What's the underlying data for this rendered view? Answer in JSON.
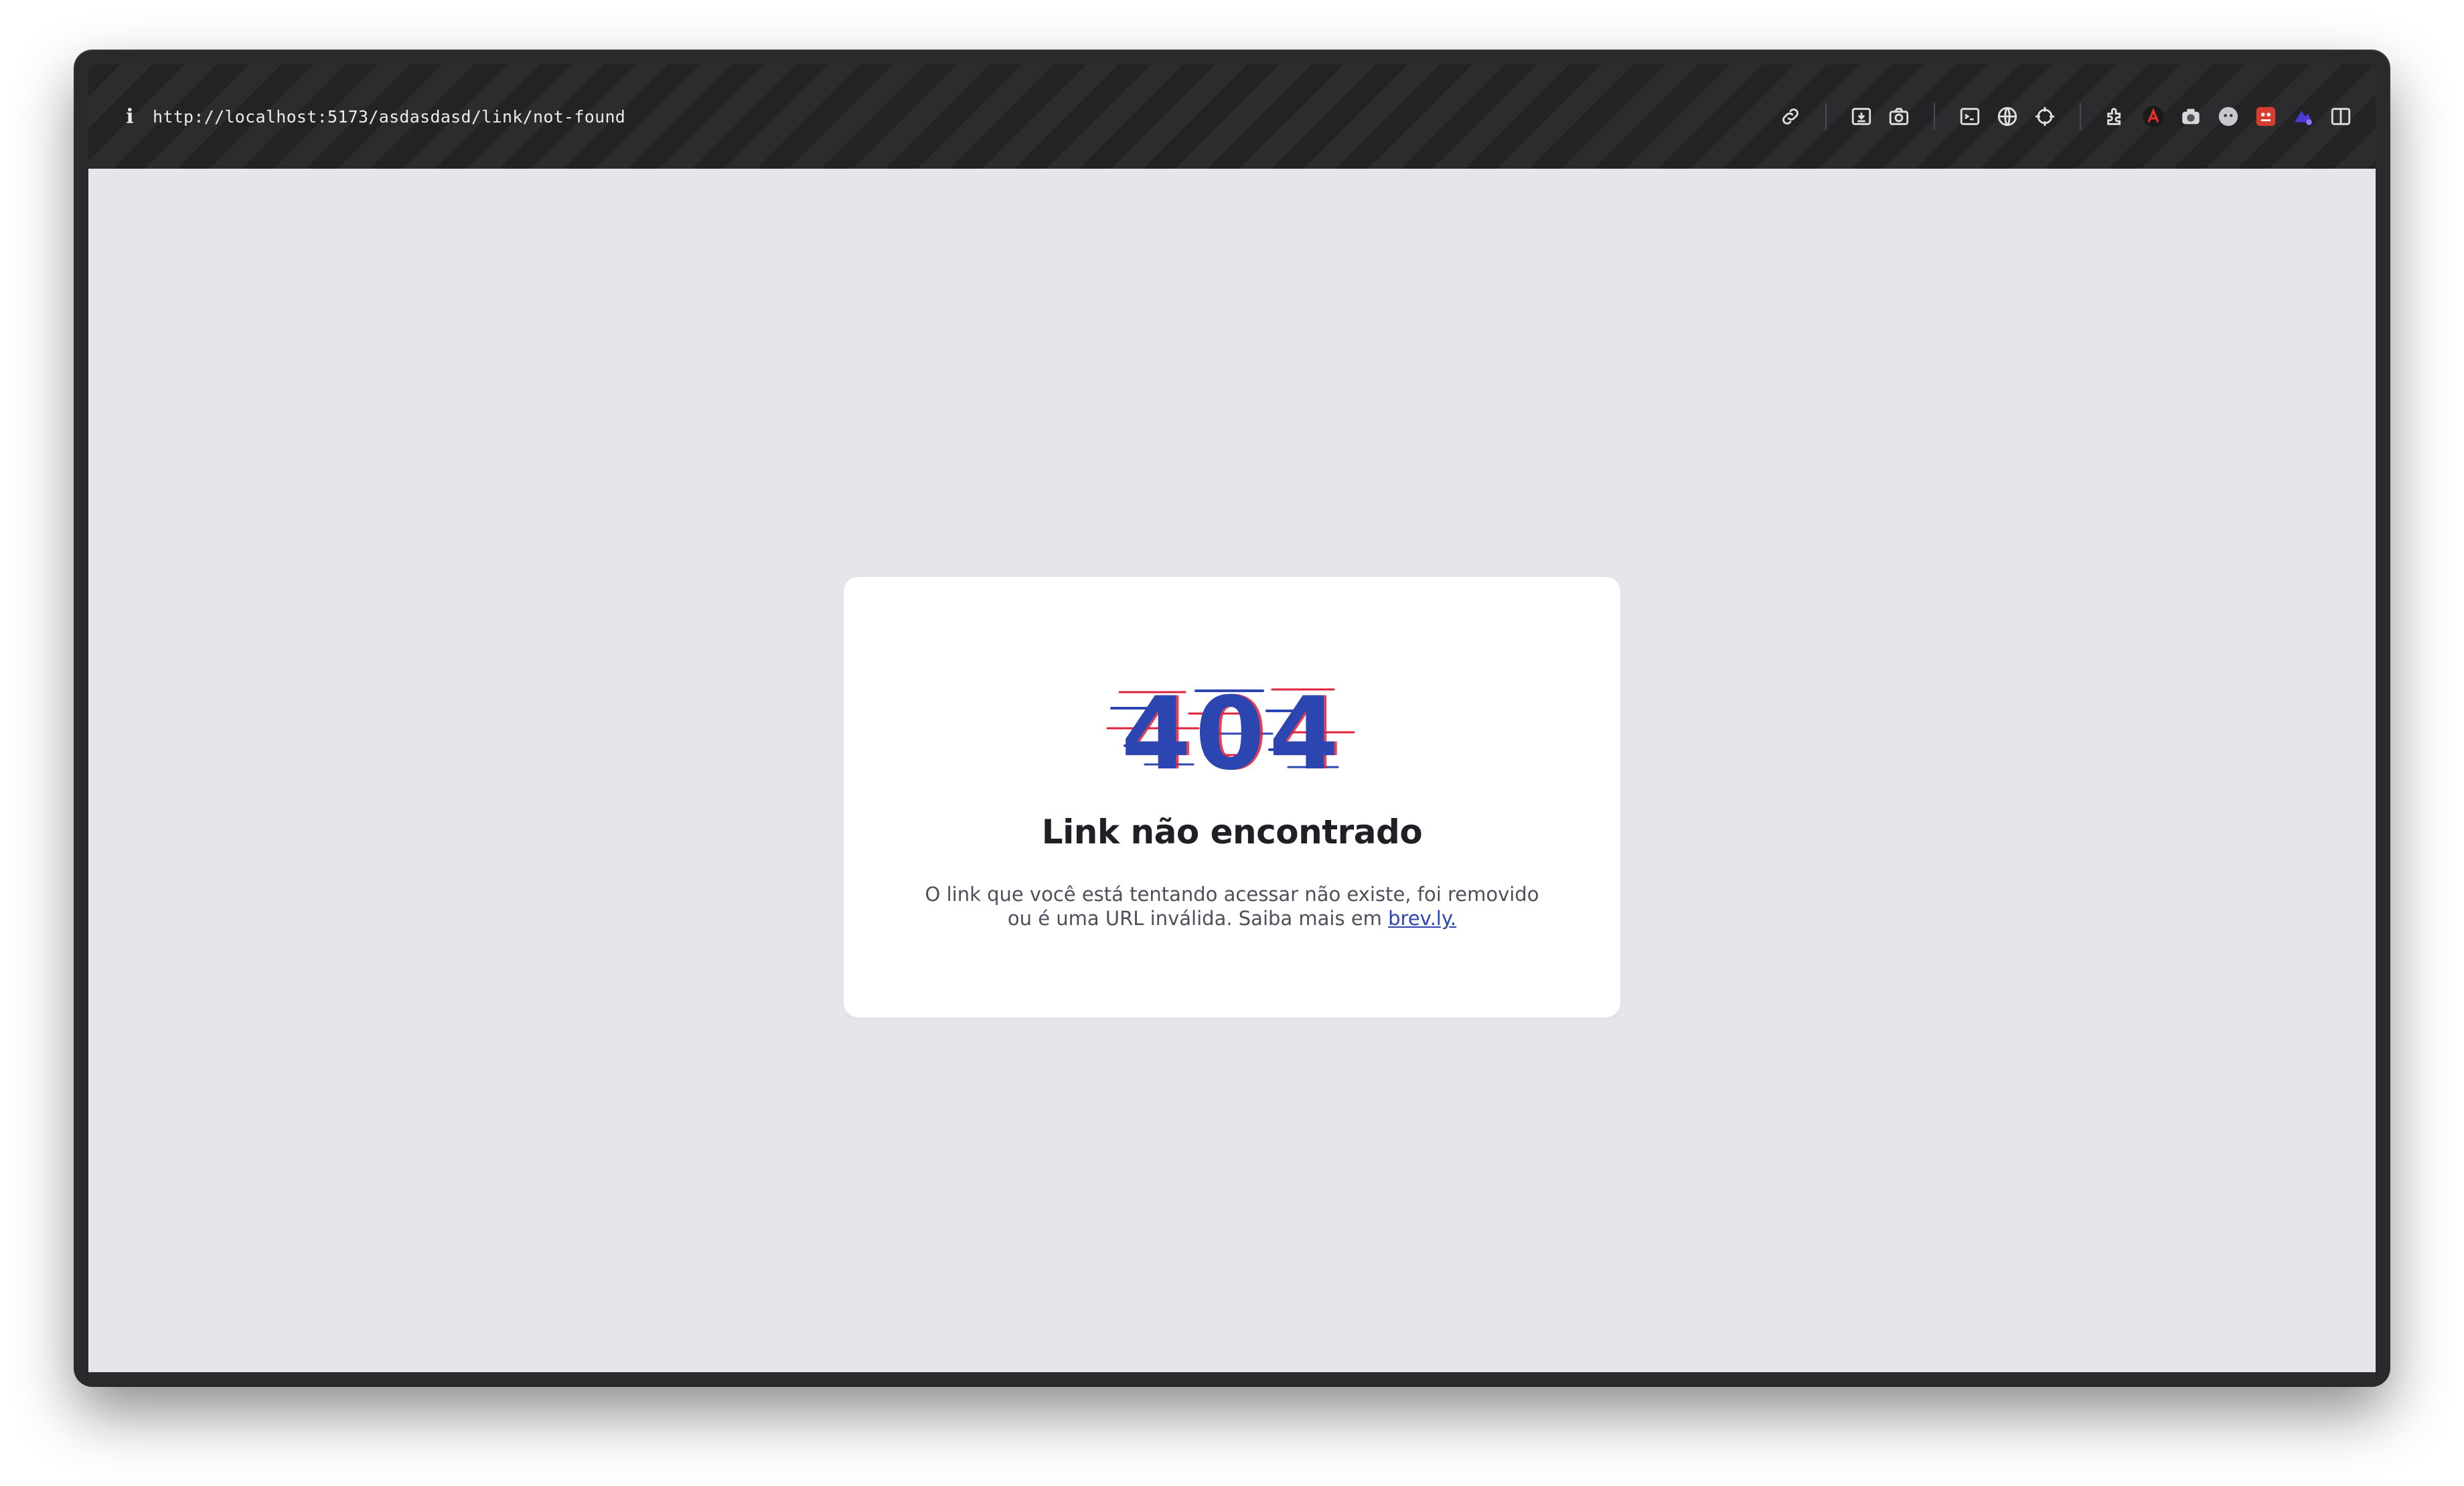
{
  "browser": {
    "url": "http://localhost:5173/asdasdasd/link/not-found",
    "info_icon": "i",
    "toolbar_icons": [
      "link-icon",
      "save-page-icon",
      "camera-icon",
      "terminal-icon",
      "globe-icon",
      "crosshair-icon",
      "extensions-icon",
      "extension-red-a-icon",
      "extension-camera-icon",
      "extension-ghost-icon",
      "extension-red-icon",
      "extension-purple-icon",
      "sidebar-toggle-icon"
    ]
  },
  "page": {
    "error_code": "404",
    "title": "Link não encontrado",
    "description": "O link que você está tentando acessar não existe, foi removido ou é uma URL inválida. Saiba mais em ",
    "link_text": "brev.ly.",
    "colors": {
      "background": "#e4e6eb",
      "card": "#ffffff",
      "accent": "#2c46b1",
      "glitch_red": "#e0213a",
      "title": "#1f2025",
      "text": "#4d505b"
    }
  }
}
